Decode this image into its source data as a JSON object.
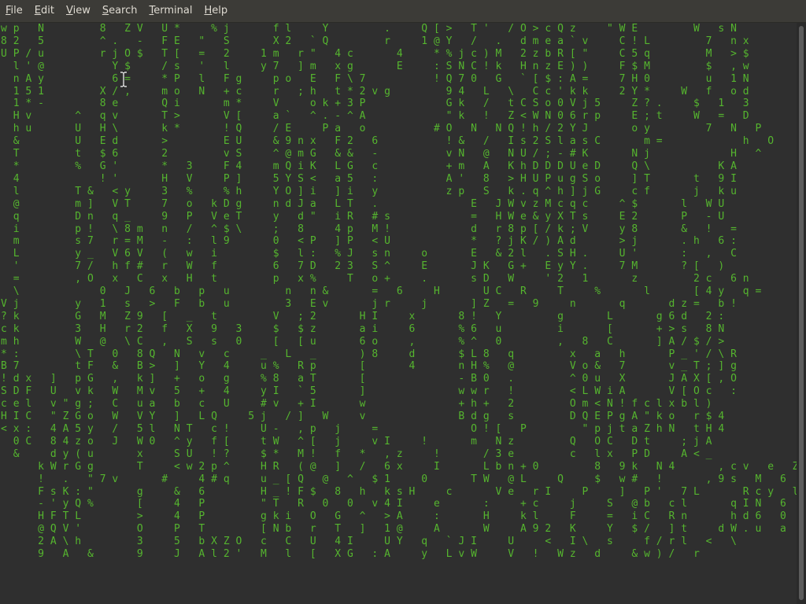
{
  "menubar": {
    "items": [
      {
        "mnemonic": "F",
        "rest": "ile"
      },
      {
        "mnemonic": "E",
        "rest": "dit"
      },
      {
        "mnemonic": "V",
        "rest": "iew"
      },
      {
        "mnemonic": "S",
        "rest": "earch"
      },
      {
        "mnemonic": "T",
        "rest": "erminal"
      },
      {
        "mnemonic": "H",
        "rest": "elp"
      }
    ]
  },
  "terminal": {
    "fg_color": "#55b52f",
    "highlight_color": "#e6e6e6",
    "bg_color": "#2f2f2f",
    "lines": [
      "w p   N         8   Z V   U *     % j       f l     Y         .     Q [ >   T '   / O > c Q z     \" W E         W   s N",
      "8 2   5         ^ .   -   F E   \"   S       X 2   ` Q         r     1 @ Y   /   .   d m e a ` v     C ! L         7   n x",
      "U P / u         r j O $   T [   =   2     1 m   r \"   4 c       4     * % j c ) M   2 z b R [ \"     C 5 q         M   > $",
      "  l ' @           Y $     / s   '   l     y 7   ] m   x g       E     : S N C ! k   H n z E ) )     F $ M         $   , w",
      "  n A y           6 =     * P   l   F g     p o   E   F \\ 7           ! Q 7 0   G   ` [ $ : A =     7 H 0         u   1 N",
      "  1 5 1         X / ,     m o   N   + c     r   ; h   t * 2 v g         9 4   L   \\   C c ' k k     2 Y *     W   f   o d",
      "  1 * -         8 e       Q i       m *     V     o k + 3 P             G k   /   t C S o 0 V j 5     Z ? .     $   1   3",
      "  H v       ^   q v       T >       V [     a `   ^ . - ^ A             \" k   !   Z < W N 0 6 r p     E ; t     W   =   D",
      "  h u       U   H \\       k *       ! Q     / E     P a   o           # O   N   N Q ! h / 2 Y J       o y         7   N   P",
      "  &         U   E d       >         E U     & 9 n x   F 2   6           ! &   /   I s 2 S l a s C       m =             h   O",
      "  T         t   $ 6       2         v S     ^ @ m G   & &   -           v N   @   N U / ; - # K       N j             H   ^",
      "  *         %   G '       *   3     F 4     m Q i K   L G   c           + m   A   K h D D D U e D     Q \\           K A",
      "  4             ! '       H   V     P ]     5 Y S <   a 5   :           A '   8   > H U P u g S o     ] T       t   9 I",
      "  l         T &   < y     3   %     % h     Y O ] i   ] i   y           z p   S   k . q ^ h ] j G     c f       j   k u",
      "  @         m ]   V T     7   o   k D g     n d J a   L T   .               E   J W v z M c q c     ^ $       l   W U",
      "  q         D n   q _     9   P   V e T     y   d \"   i R   # s             =   H W e & y X T s     E 2       P   - U",
      "  i         p !   \\ 8 m   n   /   ^ $ \\     ;   8     4 p   M !             d   r 8 p [ / k ; V     y 8       &   !   =",
      "  m         s 7   r = M   -   :   l 9       0   < P   ] P   < U             *   ? j K / ) A d       > j       . h   6 :",
      "  L         y _   V 6 V   (   w   i         $   l :   % J   s n     o       E   & 2 l   . S H .     U '       :   ,   C",
      "  '         7 /   h f #   r   W   f         6   7 D   2 3   S ^     E       J K   G +   E y Y .     7 M       ? [   )",
      "  =         , O   x   C   x   H   t         p   x %     T   o +     .       s D   W     ' 2   1       z         2 c   6 n",
      "  \\             0   J   6   b   p   u         n   n &       =   6     H       U C   R     T     %       l       [ 4 y   q =",
      "V j         y   1   s   >   F   b   u         3   E v       j r     j       ] Z   =   9     n       q       d z =   b !",
      "? k         G   M   Z 9   [   _   t         V   ; 2       H I     x       8 !   Y         g       L       g 6 d   2 :",
      "c k         3   H   r 2   f   X   9   3     $   $ z       a i     6       % 6   u         i       [       + > s   8 N",
      "m h         W   @   \\ C   ,   S   s   0     [   [ u       6 o     ,       % ^   0         ,   8   C       ] A / $ / >",
      "* :         \\ T   0   8 Q   N   v   c     _   L   _       ) 8     d       $ L 8   q         x   a   h       P _ ' / \\ R",
      "B 7         t F   &   B >   ]   Y   4     u %   R p       [       4       n H %   @         V o &   7       v _ T ; ] g",
      "! d x   ]   p G   ,   k ]   +   o   g     % 8   a T       [               - B 0   .         ^ 0 u   X       J A X [ , O",
      "S D F   U   v k   W   M v   5   +   4     y I   ` 5       ]               w w r   !         < L W i A       V [ O c   :",
      "c e l   v \" g ;   C   u a   b   c   U     # v   + I       w               + h +   2         O m < N ! f c l x b l )",
      "H I C   \" Z G o   W   V Y   ]   L Q     5 j   / ]   W     v               B d g   s         D Q E P g A \" k o   r $ 4",
      "< x :   4 A 5 y   /   5 l   N T   c !     U -   , p   j     =               O ! [   P         \" p j t a Z h N   t H 4",
      "  0 C   8 4 z o   J   W 0   ^ y   f [     t W   ^ [   j     v I     !       m   N z         Q   O C   D t     ; j A",
      "  &     d y ( u       x     S U   ! ?     $ *   M !   f   *   , z     !       / 3 e         c   l x   P D     A < _",
      "      k W r G g       T     < w 2 p ^     H R   ( @   ]   /   6 x     I       L b n + 0         8   9 k   N 4       , c v   e   Z",
      "      !   .   \" 7 v       #     4 # q     u _ [ Q   @   ^   $ 1     0       T W   @ L     Q     $   w #   !       , 9 s   M   6",
      "      F s K : \"       g     &   6         H _ ! F $   8   h   k s H     c       V e   r I     P     ]   P '   7 L       R c y   l   A",
      "      - ' y Q %       [     4   P         \" T   R   0   0   v 4 I     e       :     + c     j     S   @ b   c l       q I N   6   4",
      "      H F T L         >     4   P         g k i   O   G   ^   > A     :       H     k l     F     =   i C   R n       h d 6   0   <",
      "      @ Q V '         O     P   T         [ N b   r   T   ]   1 @     A       W     A 9 2   K     Y   $ /   ] t     d W . u   a   <",
      "      2 A \\ h         3     5   b X Z O   c   C   U   4 I     U Y   q   ` J I     U     <   I \\   s     f / r l   <   \\",
      "      9   A   &       9     J   A l 2 '   M   l   [   X G   : A     y   L v W     V   !   W z   d     & w ) /   r"
    ]
  }
}
